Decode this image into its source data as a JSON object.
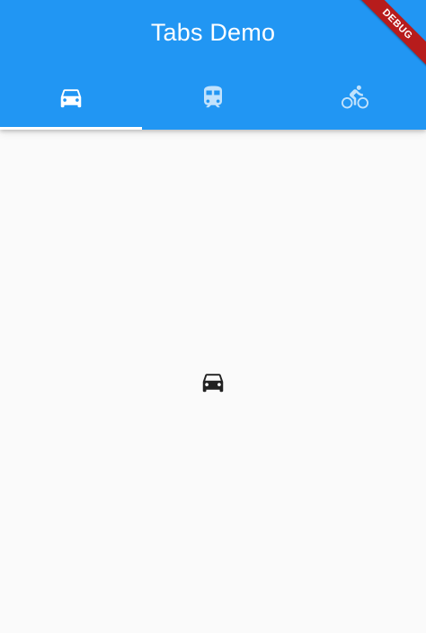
{
  "app_bar": {
    "title": "Tabs Demo",
    "background_color": "#2196f3"
  },
  "tabs": [
    {
      "icon": "directions-car-icon",
      "selected": true
    },
    {
      "icon": "directions-transit-icon",
      "selected": false
    },
    {
      "icon": "directions-bike-icon",
      "selected": false
    }
  ],
  "content": {
    "icon": "directions-car-icon"
  },
  "debug_banner": {
    "label": "DEBUG",
    "color": "#b71c1c"
  }
}
